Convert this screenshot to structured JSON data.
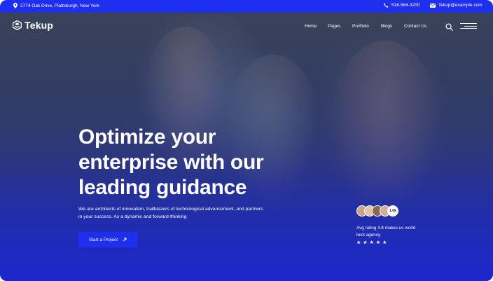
{
  "topbar": {
    "address": "2774 Oak Drive, Plattsburgh, New York",
    "phone": "518-564-3200",
    "email": "Tekup@example.com"
  },
  "brand": {
    "name": "Tekup"
  },
  "nav": {
    "items": [
      {
        "label": "Home"
      },
      {
        "label": "Pages"
      },
      {
        "label": "Portfolio"
      },
      {
        "label": "Blogs"
      },
      {
        "label": "Contact Us"
      }
    ]
  },
  "hero": {
    "headline_lines": [
      "Optimize your",
      "enterprise with our",
      "leading guidance"
    ],
    "subtext": "We are architects of innovation, trailblazers of technological advancement, and partners in your success. As a dynamic and forward-thinking",
    "cta_label": "Start a Project"
  },
  "rating": {
    "avatar_count_label": "1.6k",
    "text": "Avg rating 4.8 makes us world best agency.",
    "stars": 5
  },
  "colors": {
    "accent": "#1f2ff0",
    "text": "#ffffff"
  },
  "icons": {
    "address": "location-pin-icon",
    "phone": "phone-icon",
    "email": "mail-icon",
    "logo": "tekup-logo-icon",
    "search": "search-icon",
    "menu": "menu-icon",
    "cta": "arrow-up-right-icon",
    "star": "star-icon"
  }
}
